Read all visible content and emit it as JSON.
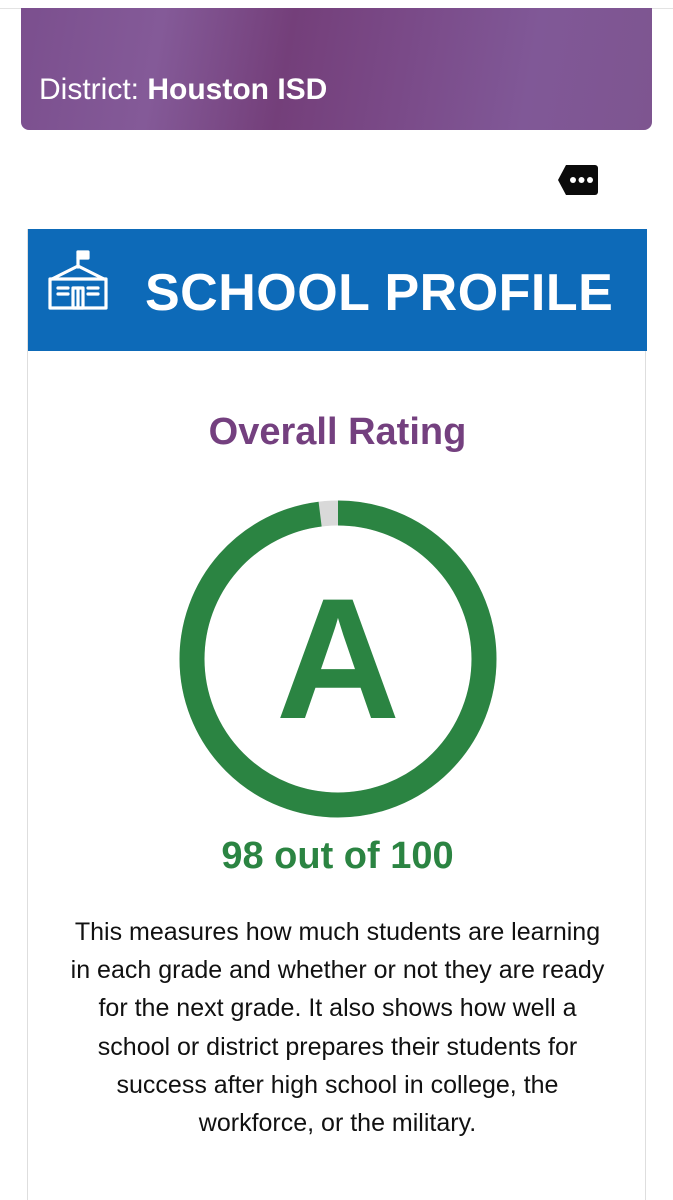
{
  "district": {
    "label": "District:",
    "name": "Houston ISD"
  },
  "more_button": {
    "icon": "more-ellipsis-icon"
  },
  "profile": {
    "icon": "school-building-icon",
    "title": "SCHOOL PROFILE"
  },
  "rating": {
    "heading": "Overall Rating",
    "grade": "A",
    "score": 98,
    "max": 100,
    "score_text": "98 out of 100",
    "description": "This measures how much students are learning in each grade and whether or not they are ready for the next grade. It also shows how well a school or district prepares their students for success after high school in college, the workforce, or the military."
  },
  "colors": {
    "district_banner": "#7b4f8e",
    "header_blue": "#0d6ab8",
    "heading_purple": "#74407f",
    "rating_green": "#2b8442",
    "gauge_track": "#d9d9d9"
  }
}
